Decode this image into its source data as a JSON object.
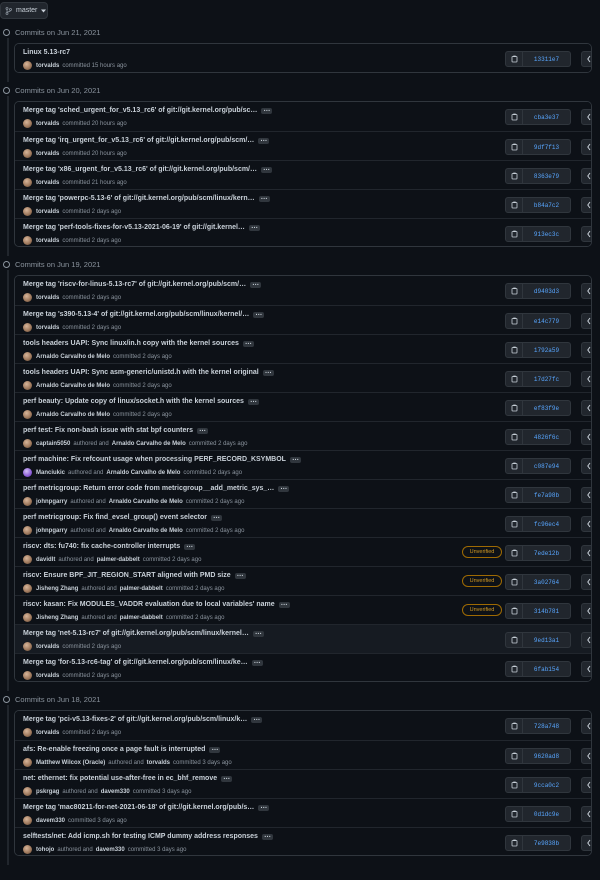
{
  "branch": {
    "label": "master",
    "icon": "git-branch-icon"
  },
  "colors": {
    "bg": "#0d1117",
    "border": "#30363d",
    "sha": "#58a6ff",
    "unverified": "#d29922"
  },
  "groups": [
    {
      "date": "Commits on Jun 21, 2021",
      "commits": [
        {
          "title": "Linux 5.13-rc7",
          "ellipsis": false,
          "authors": [
            "torvalds"
          ],
          "action": "committed 15 hours ago",
          "sha": "13311e7"
        }
      ]
    },
    {
      "date": "Commits on Jun 20, 2021",
      "commits": [
        {
          "title": "Merge tag 'sched_urgent_for_v5.13_rc6' of git://git.kernel.org/pub/sc…",
          "ellipsis": true,
          "authors": [
            "torvalds"
          ],
          "action": "committed 20 hours ago",
          "sha": "cba3e37"
        },
        {
          "title": "Merge tag 'irq_urgent_for_v5.13_rc6' of git://git.kernel.org/pub/scm/…",
          "ellipsis": true,
          "authors": [
            "torvalds"
          ],
          "action": "committed 20 hours ago",
          "sha": "9df7f13"
        },
        {
          "title": "Merge tag 'x86_urgent_for_v5.13_rc6' of git://git.kernel.org/pub/scm/…",
          "ellipsis": true,
          "authors": [
            "torvalds"
          ],
          "action": "committed 21 hours ago",
          "sha": "8363e79"
        },
        {
          "title": "Merge tag 'powerpc-5.13-6' of git://git.kernel.org/pub/scm/linux/kern…",
          "ellipsis": true,
          "authors": [
            "torvalds"
          ],
          "action": "committed 2 days ago",
          "sha": "b84a7c2"
        },
        {
          "title": "Merge tag 'perf-tools-fixes-for-v5.13-2021-06-19' of git://git.kernel…",
          "ellipsis": true,
          "authors": [
            "torvalds"
          ],
          "action": "committed 2 days ago",
          "sha": "913ec3c"
        }
      ]
    },
    {
      "date": "Commits on Jun 19, 2021",
      "commits": [
        {
          "title": "Merge tag 'riscv-for-linus-5.13-rc7' of git://git.kernel.org/pub/scm/…",
          "ellipsis": true,
          "authors": [
            "torvalds"
          ],
          "action": "committed 2 days ago",
          "sha": "d9403d3"
        },
        {
          "title": "Merge tag 's390-5.13-4' of git://git.kernel.org/pub/scm/linux/kernel/…",
          "ellipsis": true,
          "authors": [
            "torvalds"
          ],
          "action": "committed 2 days ago",
          "sha": "e14c779"
        },
        {
          "title": "tools headers UAPI: Sync linux/in.h copy with the kernel sources",
          "ellipsis": true,
          "authors": [
            "Arnaldo Carvalho de Melo"
          ],
          "action": "committed 2 days ago",
          "sha": "1792a59"
        },
        {
          "title": "tools headers UAPI: Sync asm-generic/unistd.h with the kernel original",
          "ellipsis": true,
          "authors": [
            "Arnaldo Carvalho de Melo"
          ],
          "action": "committed 2 days ago",
          "sha": "17d27fc"
        },
        {
          "title": "perf beauty: Update copy of linux/socket.h with the kernel sources",
          "ellipsis": true,
          "authors": [
            "Arnaldo Carvalho de Melo"
          ],
          "action": "committed 2 days ago",
          "sha": "ef83f9e"
        },
        {
          "title": "perf test: Fix non-bash issue with stat bpf counters",
          "ellipsis": true,
          "authors": [
            "captain5050",
            "Arnaldo Carvalho de Melo"
          ],
          "action": "committed 2 days ago",
          "sha": "4826f6c"
        },
        {
          "title": "perf machine: Fix refcount usage when processing PERF_RECORD_KSYMBOL",
          "ellipsis": true,
          "authors": [
            "Manciukic",
            "Arnaldo Carvalho de Melo"
          ],
          "action": "committed 2 days ago",
          "sha": "c087e94",
          "avatar": "purple"
        },
        {
          "title": "perf metricgroup: Return error code from metricgroup__add_metric_sys_…",
          "ellipsis": true,
          "authors": [
            "johnpgarry",
            "Arnaldo Carvalho de Melo"
          ],
          "action": "committed 2 days ago",
          "sha": "fe7a98b"
        },
        {
          "title": "perf metricgroup: Fix find_evsel_group() event selector",
          "ellipsis": true,
          "authors": [
            "johnpgarry",
            "Arnaldo Carvalho de Melo"
          ],
          "action": "committed 2 days ago",
          "sha": "fc96ec4"
        },
        {
          "title": "riscv: dts: fu740: fix cache-controller interrupts",
          "ellipsis": true,
          "authors": [
            "davidlt",
            "palmer-dabbelt"
          ],
          "action": "committed 2 days ago",
          "sha": "7ede12b",
          "badge": "Unverified"
        },
        {
          "title": "riscv: Ensure BPF_JIT_REGION_START aligned with PMD size",
          "ellipsis": true,
          "authors": [
            "Jisheng Zhang",
            "palmer-dabbelt"
          ],
          "action": "committed 2 days ago",
          "sha": "3a02764",
          "badge": "Unverified"
        },
        {
          "title": "riscv: kasan: Fix MODULES_VADDR evaluation due to local variables' name",
          "ellipsis": true,
          "authors": [
            "Jisheng Zhang",
            "palmer-dabbelt"
          ],
          "action": "committed 2 days ago",
          "sha": "314b781",
          "badge": "Unverified"
        },
        {
          "title": "Merge tag 'net-5.13-rc7' of git://git.kernel.org/pub/scm/linux/kernel…",
          "ellipsis": true,
          "authors": [
            "torvalds"
          ],
          "action": "committed 2 days ago",
          "sha": "9ed13a1",
          "tinted": true
        },
        {
          "title": "Merge tag 'for-5.13-rc6-tag' of git://git.kernel.org/pub/scm/linux/ke…",
          "ellipsis": true,
          "authors": [
            "torvalds"
          ],
          "action": "committed 2 days ago",
          "sha": "6fab154"
        }
      ]
    },
    {
      "date": "Commits on Jun 18, 2021",
      "commits": [
        {
          "title": "Merge tag 'pci-v5.13-fixes-2' of git://git.kernel.org/pub/scm/linux/k…",
          "ellipsis": true,
          "authors": [
            "torvalds"
          ],
          "action": "committed 2 days ago",
          "sha": "728a748"
        },
        {
          "title": "afs: Re-enable freezing once a page fault is interrupted",
          "ellipsis": true,
          "authors": [
            "Matthew Wilcox (Oracle)",
            "torvalds"
          ],
          "action": "committed 3 days ago",
          "sha": "9620ad8"
        },
        {
          "title": "net: ethernet: fix potential use-after-free in ec_bhf_remove",
          "ellipsis": true,
          "authors": [
            "pskrgag",
            "davem330"
          ],
          "action": "committed 3 days ago",
          "sha": "9cca0c2"
        },
        {
          "title": "Merge tag 'mac80211-for-net-2021-06-18' of git://git.kernel.org/pub/s…",
          "ellipsis": true,
          "authors": [
            "davem330"
          ],
          "action": "committed 3 days ago",
          "sha": "0d1dc9e"
        },
        {
          "title": "selftests/net: Add icmp.sh for testing ICMP dummy address responses",
          "ellipsis": true,
          "authors": [
            "tohojo",
            "davem330"
          ],
          "action": "committed 3 days ago",
          "sha": "7e9838b"
        }
      ]
    }
  ],
  "labels": {
    "authored_and": "authored and"
  }
}
